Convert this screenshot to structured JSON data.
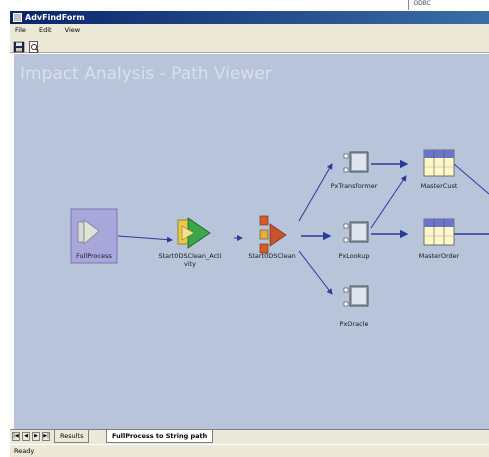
{
  "corner_label": "ODBC",
  "window": {
    "title": "AdvFindForm"
  },
  "menu": [
    "File",
    "Edit",
    "View"
  ],
  "toolbar": {
    "buttons": [
      "save-icon",
      "print-preview-icon"
    ]
  },
  "canvas": {
    "heading": "Impact Analysis - Path Viewer",
    "nodes": [
      {
        "id": "fullprocess",
        "label": "FullProcess",
        "icon": "process-icon",
        "selected": true
      },
      {
        "id": "start_activity",
        "label": "Start0DSClean_Acti vity",
        "icon": "activity-icon"
      },
      {
        "id": "start_clean",
        "label": "Start0DSClean",
        "icon": "job-icon"
      },
      {
        "id": "pxtransformer",
        "label": "PxTransformer",
        "icon": "stage-icon"
      },
      {
        "id": "pxlookup",
        "label": "PxLookup",
        "icon": "stage-icon"
      },
      {
        "id": "pxoracle",
        "label": "PxOracle",
        "icon": "stage-icon"
      },
      {
        "id": "mastercust",
        "label": "MasterCust",
        "icon": "table-icon"
      },
      {
        "id": "masterorder",
        "label": "MasterOrder",
        "icon": "table-icon"
      }
    ]
  },
  "tabs": {
    "results": "Results",
    "path": "FullProcess to String path"
  },
  "status": "Ready",
  "colors": {
    "canvas": "#b7c4d9",
    "arrow": "#2a3a9a",
    "titlebar": "#0a246a"
  }
}
